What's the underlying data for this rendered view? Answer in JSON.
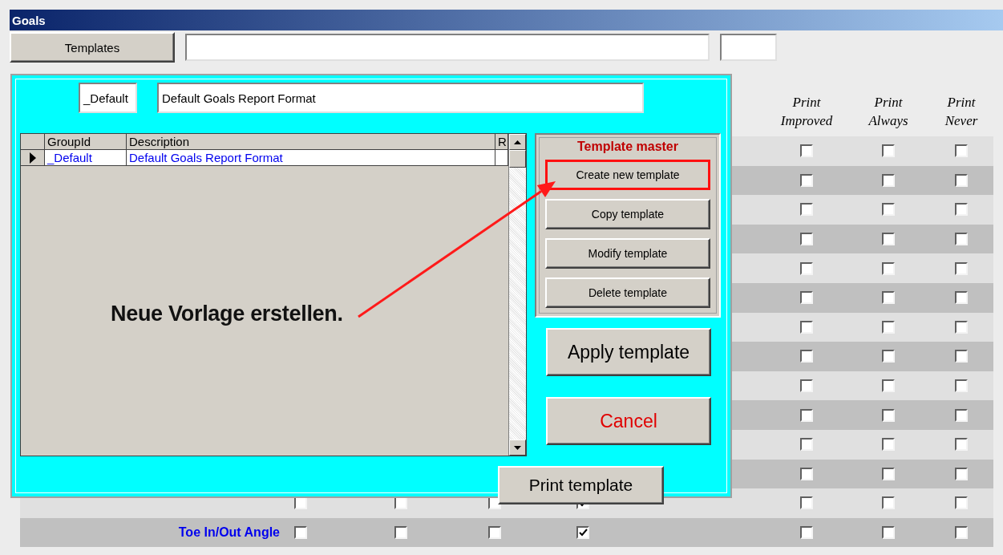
{
  "window": {
    "title": "Goals"
  },
  "toolbar": {
    "templates_button": "Templates"
  },
  "columns": [
    "Print Improved",
    "Print Always",
    "Print Never"
  ],
  "rows": [
    {
      "print": [
        false,
        false,
        false
      ]
    },
    {
      "print": [
        false,
        false,
        false
      ]
    },
    {
      "print": [
        false,
        false,
        false
      ]
    },
    {
      "print": [
        false,
        false,
        false
      ]
    },
    {
      "print": [
        false,
        false,
        false
      ]
    },
    {
      "print": [
        false,
        false,
        false
      ]
    },
    {
      "print": [
        false,
        false,
        false
      ]
    },
    {
      "print": [
        false,
        false,
        false
      ]
    },
    {
      "print": [
        false,
        false,
        false
      ]
    },
    {
      "print": [
        false,
        false,
        false
      ]
    },
    {
      "print": [
        false,
        false,
        false
      ]
    },
    {
      "print": [
        false,
        false,
        false
      ]
    },
    {
      "left": [
        false,
        false,
        false,
        true
      ],
      "print": [
        false,
        false,
        false
      ]
    },
    {
      "label": "Toe In/Out Angle",
      "left": [
        false,
        false,
        false,
        true
      ],
      "print": [
        false,
        false,
        false
      ]
    }
  ],
  "dialog": {
    "code": "_Default",
    "description": "Default Goals Report Format",
    "grid": {
      "columns": [
        "GroupId",
        "Description",
        "R"
      ],
      "rows": [
        {
          "selected": true,
          "cells": [
            "_Default",
            "Default Goals Report Format"
          ]
        }
      ]
    },
    "panel": {
      "title": "Template master",
      "buttons": [
        {
          "label": "Create new template",
          "highlighted": true
        },
        {
          "label": "Copy template",
          "highlighted": false
        },
        {
          "label": "Modify template",
          "highlighted": false
        },
        {
          "label": "Delete template",
          "highlighted": false
        }
      ]
    },
    "actions": [
      {
        "label": "Apply template",
        "kind": "primary"
      },
      {
        "label": "Cancel",
        "kind": "cancel"
      }
    ],
    "print_button": "Print template"
  },
  "annotation": {
    "text": "Neue Vorlage erstellen."
  }
}
